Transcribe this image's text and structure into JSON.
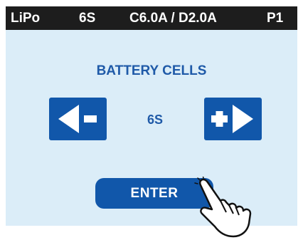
{
  "status_bar": {
    "chemistry": "LiPo",
    "cells": "6S",
    "rate": "C6.0A / D2.0A",
    "program": "P1"
  },
  "screen": {
    "title": "BATTERY CELLS",
    "value": "6S",
    "enter_label": "ENTER"
  },
  "icons": {
    "decrement": "left-arrow-minus-icon",
    "increment": "plus-right-arrow-icon",
    "pointer": "pointing-hand-icon"
  },
  "colors": {
    "accent": "#1157aa",
    "screen_bg": "#dbedf8",
    "status_bg": "#1d1d1d"
  }
}
